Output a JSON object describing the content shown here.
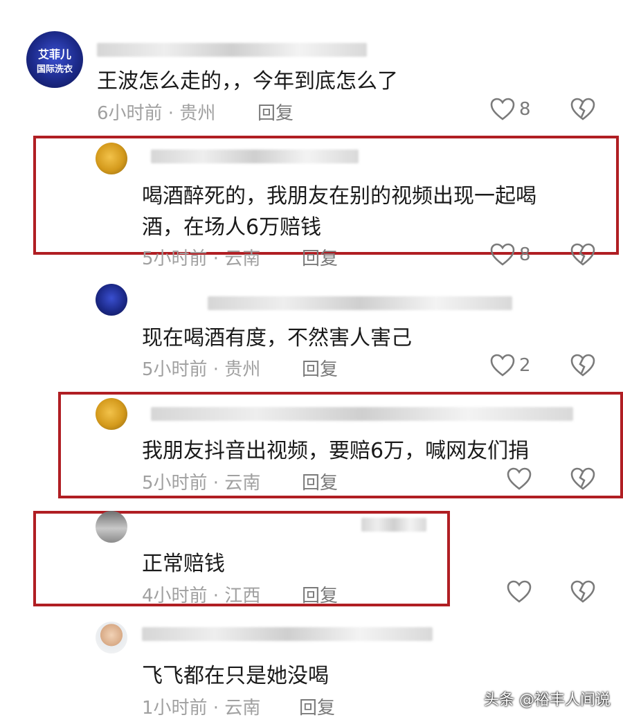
{
  "comments": [
    {
      "text": "王波怎么走的，，今年到底怎么了",
      "meta": "6小时前 · 贵州",
      "reply": "回复",
      "likes": "8"
    },
    {
      "text_line1": "喝酒醉死的，我朋友在别的视频出现一起喝",
      "text_line2": "酒，在场人6万赔钱",
      "meta": "5小时前 · 云南",
      "reply": "回复",
      "likes": "8"
    },
    {
      "text": "现在喝酒有度，不然害人害己",
      "meta": "5小时前 · 贵州",
      "reply": "回复",
      "likes": "2"
    },
    {
      "text": "我朋友抖音出视频，要赔6万，喊网友们捐",
      "meta": "5小时前 · 云南",
      "reply": "回复",
      "likes": ""
    },
    {
      "text": "正常赔钱",
      "meta": "4小时前 · 江西",
      "reply": "回复",
      "likes": ""
    },
    {
      "text": "飞飞都在只是她没喝",
      "meta": "1小时前 · 云南",
      "reply": "回复",
      "likes": ""
    }
  ],
  "avatar_texts": {
    "a1_line1": "艾菲儿",
    "a1_line2": "国际洗衣"
  },
  "highlight_color": "#b01e23",
  "watermark": "头条 @裕丰人间说"
}
